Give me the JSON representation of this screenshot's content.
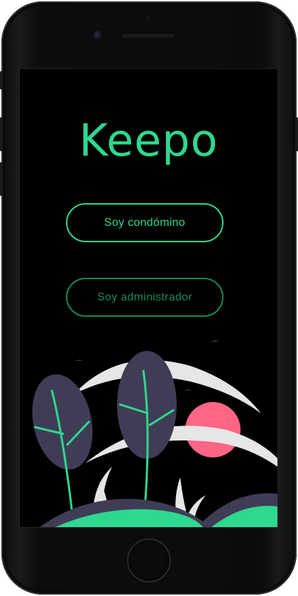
{
  "app": {
    "title": "Keepo"
  },
  "buttons": {
    "condomino_label": "Soy condómino",
    "admin_label": "Soy administrador"
  },
  "colors": {
    "accent": "#2ed88f",
    "accent_dim": "#148a57",
    "background": "#000000",
    "leaf": "#3f3d56",
    "sun": "#ff6584",
    "arc": "#e6e6e6"
  },
  "illustration": {
    "subject": "plants-moon-sun-birds"
  }
}
